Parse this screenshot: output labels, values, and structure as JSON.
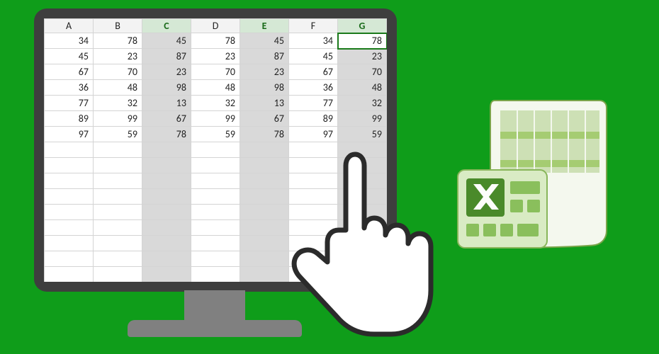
{
  "spreadsheet": {
    "columns": [
      "A",
      "B",
      "C",
      "D",
      "E",
      "F",
      "G"
    ],
    "selected_columns": [
      "C",
      "E",
      "G"
    ],
    "active_cell": {
      "col": "G",
      "row": 0
    },
    "rows": [
      {
        "A": 34,
        "B": 78,
        "C": 45,
        "D": 78,
        "E": 45,
        "F": 34,
        "G": 78
      },
      {
        "A": 45,
        "B": 23,
        "C": 87,
        "D": 23,
        "E": 87,
        "F": 45,
        "G": 23
      },
      {
        "A": 67,
        "B": 70,
        "C": 23,
        "D": 70,
        "E": 23,
        "F": 67,
        "G": 70
      },
      {
        "A": 36,
        "B": 48,
        "C": 98,
        "D": 48,
        "E": 98,
        "F": 36,
        "G": 48
      },
      {
        "A": 77,
        "B": 32,
        "C": 13,
        "D": 32,
        "E": 13,
        "F": 77,
        "G": 32
      },
      {
        "A": 89,
        "B": 99,
        "C": 67,
        "D": 99,
        "E": 67,
        "F": 89,
        "G": 99
      },
      {
        "A": 97,
        "B": 59,
        "C": 78,
        "D": 59,
        "E": 78,
        "F": 97,
        "G": 59
      }
    ],
    "blank_rows": 9
  }
}
